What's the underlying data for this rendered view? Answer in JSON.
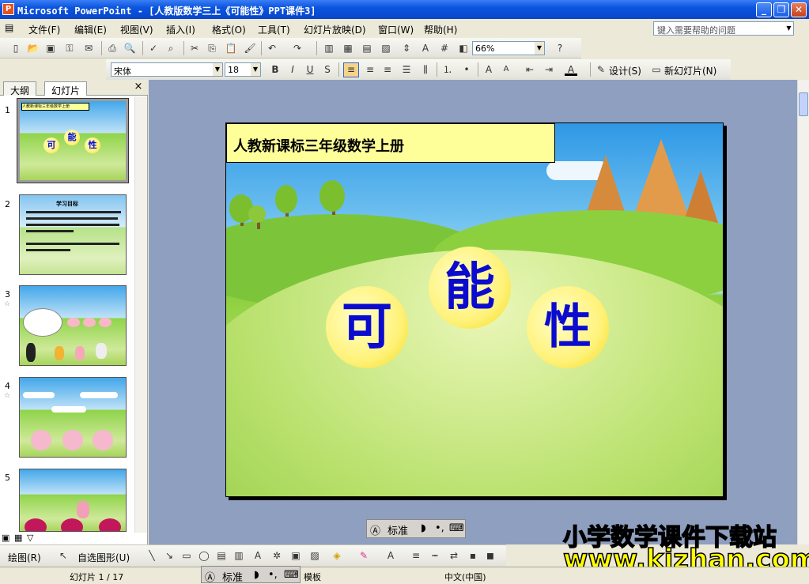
{
  "window": {
    "title": "Microsoft PowerPoint - [人教版数学三上《可能性》PPT课件3]"
  },
  "menu": {
    "items": [
      "文件(F)",
      "编辑(E)",
      "视图(V)",
      "插入(I)",
      "格式(O)",
      "工具(T)",
      "幻灯片放映(D)",
      "窗口(W)",
      "帮助(H)"
    ]
  },
  "help": {
    "placeholder": "键入需要帮助的问题"
  },
  "toolbar": {
    "zoom": "66%"
  },
  "format": {
    "font": "宋体",
    "size": "18",
    "bold": "B",
    "italic": "I",
    "underline": "U",
    "shadow": "S",
    "design": "设计(S)",
    "new_slide": "新幻灯片(N)"
  },
  "pane": {
    "tab_outline": "大纲",
    "tab_slides": "幻灯片",
    "close": "×"
  },
  "thumbnails": [
    {
      "num": "1",
      "has_star": false
    },
    {
      "num": "2",
      "has_star": false
    },
    {
      "num": "3",
      "has_star": true
    },
    {
      "num": "4",
      "has_star": true
    },
    {
      "num": "5",
      "has_star": false
    }
  ],
  "thumb_texts": {
    "t1_title": "人教新课标三年级数学上册",
    "t1_chars": [
      "可",
      "能",
      "性"
    ],
    "t2_heading": "学习目标"
  },
  "slide": {
    "title": "人教新课标三年级数学上册",
    "char1": "可",
    "char2": "能",
    "char3": "性"
  },
  "ime": {
    "label": "标准",
    "mode1": "◗",
    "mode2": "•,"
  },
  "drawbar": {
    "draw": "绘图(R)",
    "autoshapes": "自选图形(U)"
  },
  "status": {
    "slide": "幻灯片 1 / 17",
    "template": "模板",
    "language": "中文(中国)"
  },
  "watermark": {
    "line1": "小学数学课件下载站",
    "line2": "www.kjzhan.com"
  },
  "colors": {
    "titlebar": "#0a55e0",
    "canvas": "#8f9fbf",
    "title_box": "#ffff99",
    "chars": "#0b0bd0"
  }
}
